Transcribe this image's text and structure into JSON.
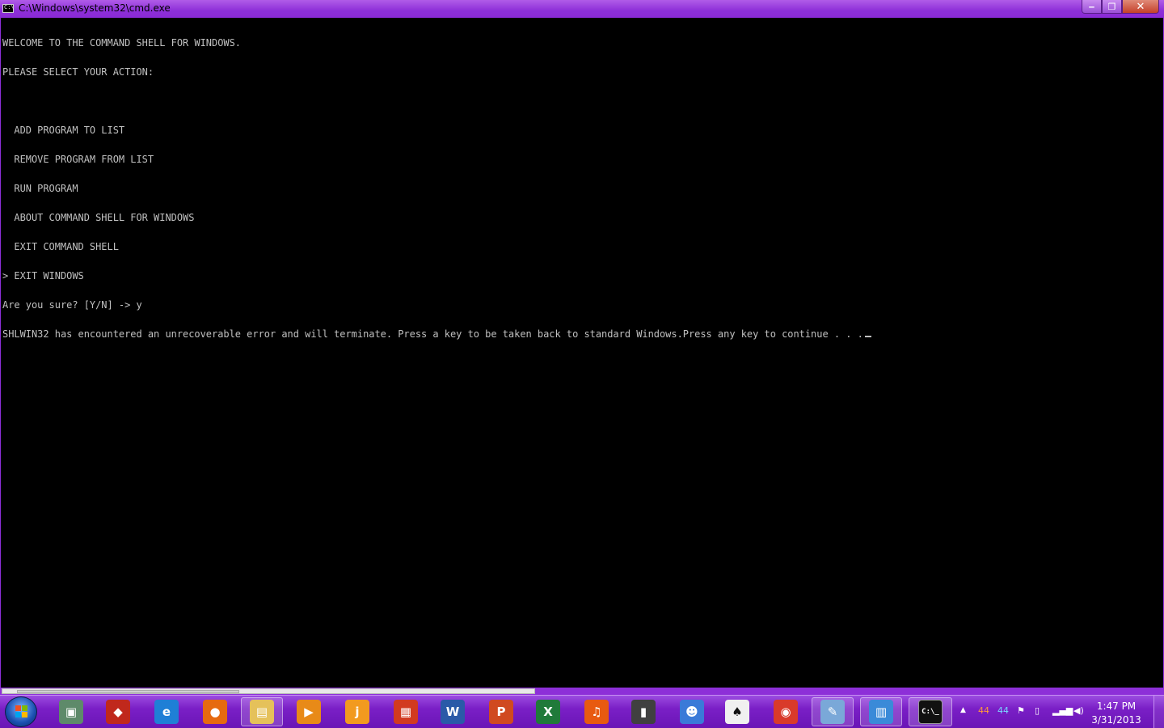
{
  "window": {
    "title": "C:\\Windows\\system32\\cmd.exe",
    "minimize_label": "‒",
    "maximize_label": "❐",
    "close_label": "✕"
  },
  "console": {
    "lines": [
      "WELCOME TO THE COMMAND SHELL FOR WINDOWS.",
      "PLEASE SELECT YOUR ACTION:",
      "",
      "  ADD PROGRAM TO LIST",
      "  REMOVE PROGRAM FROM LIST",
      "  RUN PROGRAM",
      "  ABOUT COMMAND SHELL FOR WINDOWS",
      "  EXIT COMMAND SHELL",
      "> EXIT WINDOWS",
      "Are you sure? [Y/N] -> y",
      "SHLWIN32 has encountered an unrecoverable error and will terminate. Press a key to be taken back to standard Windows.Press any key to continue . . ."
    ]
  },
  "taskbar": {
    "items": [
      {
        "name": "computer-icon",
        "glyph": "▣",
        "color": "#5e8a6a"
      },
      {
        "name": "paint-shapes-icon",
        "glyph": "◆",
        "color": "#c0281c"
      },
      {
        "name": "internet-explorer-icon",
        "glyph": "e",
        "color": "#1f7fd6"
      },
      {
        "name": "firefox-icon",
        "glyph": "●",
        "color": "#e66a10"
      },
      {
        "name": "windows-explorer-icon",
        "glyph": "▤",
        "color": "#e5c15a"
      },
      {
        "name": "media-player-icon",
        "glyph": "▶",
        "color": "#e88a18"
      },
      {
        "name": "joinme-icon",
        "glyph": "j",
        "color": "#f29a1f"
      },
      {
        "name": "office-icon",
        "glyph": "▦",
        "color": "#d23a20"
      },
      {
        "name": "word-icon",
        "glyph": "W",
        "color": "#2a5aa8"
      },
      {
        "name": "powerpoint-icon",
        "glyph": "P",
        "color": "#d04a20"
      },
      {
        "name": "excel-icon",
        "glyph": "X",
        "color": "#207a3a"
      },
      {
        "name": "audacity-icon",
        "glyph": "♫",
        "color": "#e85a10"
      },
      {
        "name": "movie-maker-icon",
        "glyph": "▮",
        "color": "#404040"
      },
      {
        "name": "user-icon",
        "glyph": "☻",
        "color": "#3a7ad8"
      },
      {
        "name": "solitaire-icon",
        "glyph": "♠",
        "color": "#f0f0f0"
      },
      {
        "name": "chrome-icon",
        "glyph": "◉",
        "color": "#d93a2a"
      },
      {
        "name": "paint-icon",
        "glyph": "✎",
        "color": "#7aa8d8"
      },
      {
        "name": "control-panel-icon",
        "glyph": "▥",
        "color": "#3a8ad8"
      },
      {
        "name": "cmd-icon",
        "glyph": "C:\\_",
        "color": "#111111"
      }
    ],
    "tray": {
      "expand_glyph": "▲",
      "temp1": "44",
      "temp2": "44",
      "time": "1:47 PM",
      "date": "3/31/2013"
    }
  },
  "colors": {
    "titlebar": "#8d2fd8",
    "console_bg": "#000000",
    "console_text": "#c0c0c0",
    "taskbar": "#7a1fc6"
  }
}
